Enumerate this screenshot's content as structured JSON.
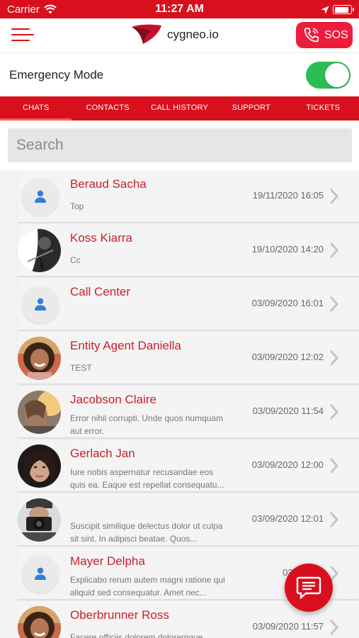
{
  "status_bar": {
    "carrier": "Carrier",
    "time": "11:27 AM",
    "battery_level": 0.95
  },
  "header": {
    "brand": "cygneo.io",
    "sos_label": "SOS"
  },
  "emergency": {
    "label": "Emergency Mode",
    "enabled": true
  },
  "tabs": [
    "CHATS",
    "CONTACTS",
    "CALL HISTORY",
    "SUPPORT",
    "TICKETS"
  ],
  "active_tab": 0,
  "search": {
    "placeholder": "Search",
    "value": ""
  },
  "chats": [
    {
      "name": "Beraud Sacha",
      "preview": "Top",
      "time": "19/11/2020 16:05",
      "avatar": "placeholder-person-icon"
    },
    {
      "name": "Koss Kiarra",
      "preview": "Cc",
      "time": "19/10/2020 14:20",
      "avatar": "photo-man-guitar"
    },
    {
      "name": "Call Center",
      "preview": "",
      "time": "03/09/2020 16:01",
      "avatar": "placeholder-person-icon"
    },
    {
      "name": "Entity Agent Daniella",
      "preview": "TEST",
      "time": "03/09/2020 12:02",
      "avatar": "photo-woman-smiling"
    },
    {
      "name": "Jacobson Claire",
      "preview": "Error nihil corrupti. Unde quos numquam aut error.",
      "time": "03/09/2020 11:54",
      "avatar": "photo-woman-sunlight"
    },
    {
      "name": "Gerlach Jan",
      "preview": "Iure nobis aspernatur recusandae eos quis ea. Eaque est repellat consequatu...",
      "time": "03/09/2020 12:00",
      "avatar": "photo-woman-dark"
    },
    {
      "name": "",
      "preview": "Suscipit similique delectus dolor ut culpa sit sint. In adipisci beatae. Quos...",
      "time": "03/09/2020 12:01",
      "avatar": "photo-man-camera"
    },
    {
      "name": "Mayer Delpha",
      "preview": "Explicabo rerum autem magni ratione qui aliquid sed consequatur. Amet nec...",
      "time": "03/09/202",
      "avatar": "placeholder-person-icon"
    },
    {
      "name": "Oberbrunner Ross",
      "preview": "Facere officiis dolorem doloremque",
      "time": "03/09/2020 11:57",
      "avatar": "photo-woman-smiling"
    }
  ],
  "colors": {
    "brand_red": "#d90f1d",
    "sos_red": "#ec1c3b",
    "name_red": "#c8212c",
    "toggle_green": "#2dbd55",
    "placeholder_icon_blue": "#2f7fd6"
  },
  "fab": {
    "icon": "chat-bubble-icon"
  }
}
